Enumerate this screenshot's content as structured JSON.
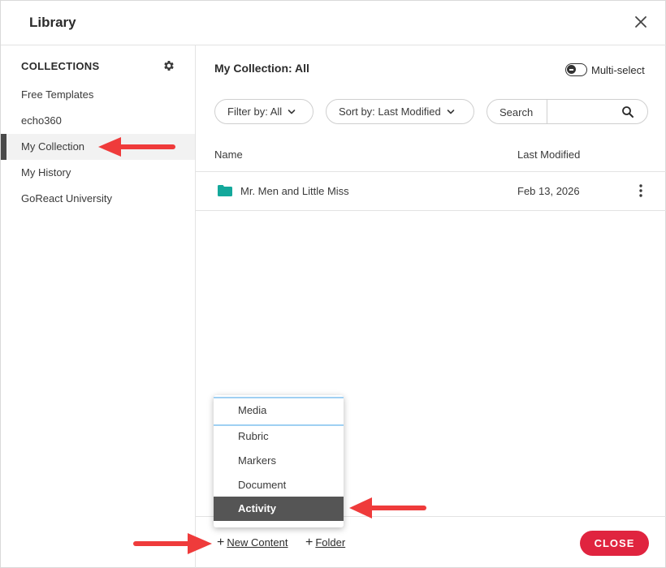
{
  "header": {
    "title": "Library"
  },
  "sidebar": {
    "heading": "COLLECTIONS",
    "items": [
      {
        "label": "Free Templates"
      },
      {
        "label": "echo360"
      },
      {
        "label": "My Collection"
      },
      {
        "label": "My History"
      },
      {
        "label": "GoReact University"
      }
    ]
  },
  "main": {
    "collection_title": "My Collection: All",
    "multi_select_label": "Multi-select",
    "filter_label": "Filter by: All",
    "sort_label": "Sort by: Last Modified",
    "search_label": "Search",
    "search_value": "",
    "columns": {
      "name": "Name",
      "modified": "Last Modified"
    },
    "rows": [
      {
        "name": "Mr. Men and Little Miss",
        "modified": "Feb 13, 2026"
      }
    ]
  },
  "menu": {
    "items": [
      {
        "label": "Media"
      },
      {
        "label": "Rubric"
      },
      {
        "label": "Markers"
      },
      {
        "label": "Document"
      },
      {
        "label": "Activity"
      }
    ]
  },
  "footer": {
    "new_content_label": "New Content",
    "new_folder_label": "Folder",
    "close_label": "CLOSE"
  },
  "colors": {
    "accent_close": "#e0243f",
    "folder": "#14a89b",
    "annotation_arrow": "#ef3b3b",
    "selected_menu": "#555555"
  },
  "icons": [
    "close-icon",
    "gear-icon",
    "chevron-down-icon",
    "search-icon",
    "folder-icon",
    "kebab-icon",
    "plus-icon"
  ]
}
